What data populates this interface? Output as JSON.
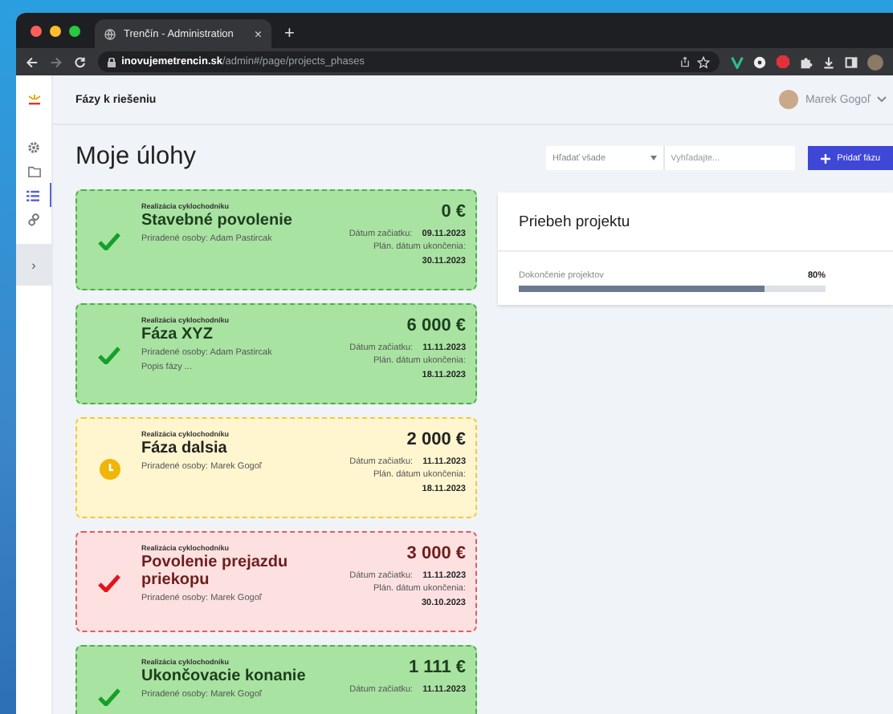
{
  "browser": {
    "tab_title": "Trenčín - Administration",
    "tab_close": "×",
    "new_tab": "+",
    "url": "**inovujemetrencin.sk**/admin#/page/projects_phases"
  },
  "header": {
    "title": "Fázy k riešeniu",
    "user": "Marek Gogoľ"
  },
  "sidebar": {
    "items": [
      {
        "kind": "gear",
        "selected": false
      },
      {
        "kind": "folder",
        "selected": false
      },
      {
        "kind": "list",
        "selected": true
      },
      {
        "kind": "link",
        "selected": false
      }
    ],
    "toggle": "›"
  },
  "page_title": "Moje úlohy",
  "search": {
    "scope": "Hľadať všade",
    "placeholder": "Vyhľadajte...",
    "add_button": "Pridať fázu"
  },
  "phases": [
    {
      "kind": "done",
      "project": "Realizácia cyklochodníku",
      "title": "Stavebné povolenie",
      "assigned": "Priradené osoby: Adam Pastircak",
      "amount": "0 €",
      "start_label": "Dátum začiatku:",
      "start_date": "09.11.2023",
      "end_label": "Plán. dátum ukončenia:",
      "end_date": "30.11.2023"
    },
    {
      "kind": "done",
      "project": "Realizácia cyklochodníku",
      "title": "Fáza XYZ",
      "assigned": "Priradené osoby: Adam Pastircak",
      "description": "Popis fázy ...",
      "amount": "6 000 €",
      "start_label": "Dátum začiatku:",
      "start_date": "11.11.2023",
      "end_label": "Plán. dátum ukončenia:",
      "end_date": "18.11.2023"
    },
    {
      "kind": "pending",
      "project": "Realizácia cyklochodníku",
      "title": "Fáza dalsia",
      "assigned": "Priradené osoby: Marek Gogoľ",
      "amount": "2 000 €",
      "start_label": "Dátum začiatku:",
      "start_date": "11.11.2023",
      "end_label": "Plán. dátum ukončenia:",
      "end_date": "18.11.2023"
    },
    {
      "kind": "rejected",
      "project": "Realizácia cyklochodníku",
      "title": "Povolenie prejazdu priekopu",
      "assigned": "Priradené osoby: Marek Gogoľ",
      "amount": "3 000 €",
      "start_label": "Dátum začiatku:",
      "start_date": "11.11.2023",
      "end_label": "Plán. dátum ukončenia:",
      "end_date": "30.10.2023"
    },
    {
      "kind": "done",
      "project": "Realizácia cyklochodníku",
      "title": "Ukončovacie konanie",
      "assigned": "Priradené osoby: Marek Gogoľ",
      "amount": "1 111 €",
      "start_label": "Dátum začiatku:",
      "start_date": "11.11.2023"
    }
  ],
  "progress": {
    "title": "Priebeh projektu",
    "label": "Dokončenie projektov",
    "reading": "80%",
    "level": 0.8
  }
}
